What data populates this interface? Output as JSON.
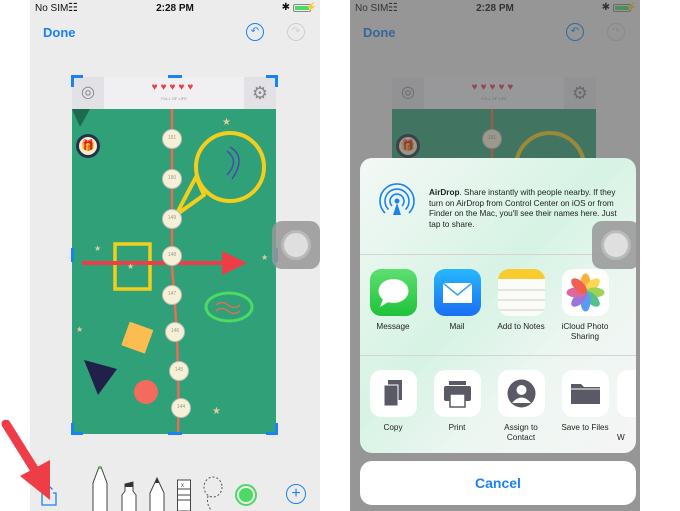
{
  "status_bar": {
    "carrier": "No SIM",
    "time": "2:28 PM",
    "battery_color": "#4cd964"
  },
  "markup_editor": {
    "done_label": "Done",
    "undo_icon": "undo-icon",
    "redo_icon": "redo-icon",
    "game": {
      "hearts": "♥♥♥♥♥",
      "status_text": "FULL OF LIFE",
      "level_nodes": [
        "151",
        "150",
        "149",
        "148",
        "147",
        "146",
        "145",
        "144"
      ],
      "background_color": "#2fa077"
    },
    "toolbar": {
      "share_icon": "share-icon",
      "tools": [
        "pen",
        "marker",
        "pencil",
        "eraser",
        "lasso"
      ],
      "selected_color": "#4cd964",
      "add_icon": "add-icon"
    },
    "accent_color": "#1a82f7"
  },
  "share_sheet": {
    "airdrop": {
      "title": "AirDrop",
      "description": ". Share instantly with people nearby. If they turn on AirDrop from Control Center on iOS or from Finder on the Mac, you'll see their names here. Just tap to share."
    },
    "apps": [
      {
        "label": "Message",
        "icon": "message-icon"
      },
      {
        "label": "Mail",
        "icon": "mail-icon"
      },
      {
        "label": "Add to Notes",
        "icon": "notes-icon"
      },
      {
        "label": "iCloud Photo Sharing",
        "icon": "photos-icon"
      }
    ],
    "actions": [
      {
        "label": "Copy",
        "icon": "copy-icon"
      },
      {
        "label": "Print",
        "icon": "print-icon"
      },
      {
        "label": "Assign to Contact",
        "icon": "contact-icon"
      },
      {
        "label": "Save to Files",
        "icon": "folder-icon"
      },
      {
        "label": "W",
        "icon": "partial-action"
      }
    ],
    "cancel_label": "Cancel"
  }
}
